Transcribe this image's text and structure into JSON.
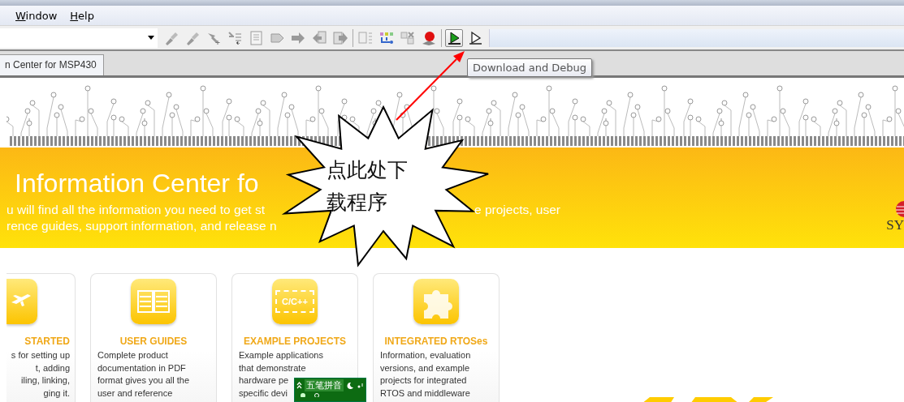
{
  "menu": [
    {
      "label": "Window"
    },
    {
      "label": "Help"
    }
  ],
  "toolbar": {
    "buttons": [
      {
        "kind": "pin",
        "highlighted": false
      },
      {
        "kind": "pin",
        "highlighted": false
      },
      {
        "kind": "pin-plus",
        "highlighted": false
      },
      {
        "kind": "list-down",
        "highlighted": false
      },
      {
        "kind": "doc",
        "highlighted": false
      },
      {
        "kind": "tag",
        "highlighted": false
      },
      {
        "kind": "arrow-right",
        "highlighted": false
      },
      {
        "kind": "arrow-left-doc",
        "highlighted": false
      },
      {
        "kind": "doc-arrow",
        "highlighted": false
      },
      {
        "kind": "separator"
      },
      {
        "kind": "doc-list",
        "highlighted": false
      },
      {
        "kind": "grid",
        "highlighted": false
      },
      {
        "kind": "grid-x",
        "highlighted": false
      },
      {
        "kind": "record",
        "highlighted": false
      },
      {
        "kind": "separator"
      },
      {
        "kind": "play-green",
        "highlighted": true
      },
      {
        "kind": "play-outline",
        "highlighted": false
      }
    ]
  },
  "tabs": [
    {
      "label": "n Center for MSP430",
      "selected": true
    }
  ],
  "tooltip": "Download and Debug",
  "banner": {
    "title": "Information Center fo",
    "line_1": [
      "u will find all the information you need to get st",
      "e projects, user"
    ],
    "line_2": "rence guides, support information, and release n",
    "logo_text": "SY"
  },
  "cards": [
    {
      "title": "STARTED",
      "lines": [
        "s for setting up",
        "t, adding",
        "iling, linking,",
        "ging it."
      ]
    },
    {
      "title": "USER GUIDES",
      "lines": [
        "Complete product",
        "documentation in PDF",
        "format gives you all the",
        "user and reference"
      ]
    },
    {
      "title": "EXAMPLE PROJECTS",
      "lines": [
        "Example applications",
        "that demonstrate",
        "hardware pe",
        "specific devi"
      ],
      "chip_label": "C/C++"
    },
    {
      "title": "INTEGRATED RTOSes",
      "lines": [
        "Information, evaluation",
        "versions, and example",
        "projects for integrated",
        "RTOS and middleware"
      ]
    }
  ],
  "callout": "点此处下载程序",
  "ime_bar": {
    "label": "五笔拼音"
  }
}
